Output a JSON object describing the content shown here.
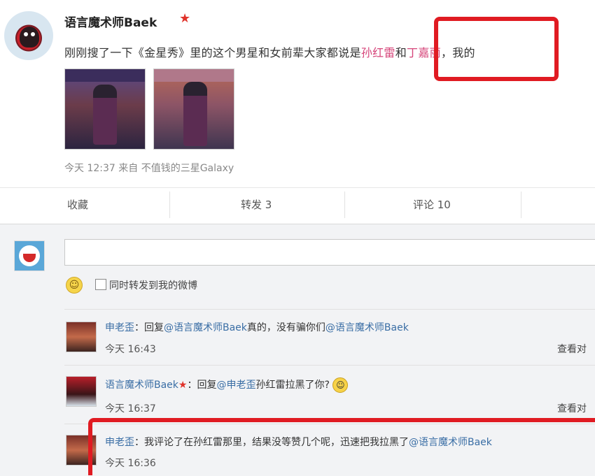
{
  "post": {
    "username": "语言魔术师Baek",
    "star": "★",
    "text_before": "刚刚搜了一下《金星秀》里的这个男星和女前辈大家都说是",
    "name1": "孙红雷",
    "and": "和",
    "name2": "丁嘉丽",
    "text_after": "，我的",
    "meta": "今天 12:37 来自 不值钱的三星Galaxy"
  },
  "actions": {
    "favorite": "收藏",
    "repost": "转发 3",
    "comment": "评论 10"
  },
  "composer": {
    "emoji": "☺",
    "repost_label": "同时转发到我的微博"
  },
  "comments": [
    {
      "user": "申老歪",
      "reply_prefix": "：回复",
      "mention": "@语言魔术师Baek",
      "text": "真的，没有骗你们",
      "mention2": "@语言魔术师Baek",
      "time": "今天 16:43",
      "action": "查看对"
    },
    {
      "user": "语言魔术师Baek",
      "star": "★",
      "reply_prefix": "：回复",
      "mention": "@申老歪",
      "text": "孙红雷拉黑了你?",
      "time": "今天 16:37",
      "action": "查看对"
    },
    {
      "user": "申老歪",
      "text": "：我评论了在孙红雷那里，结果没等赞几个呢，迅速把我拉黑了",
      "mention": "@语言魔术师Baek",
      "time": "今天 16:36"
    }
  ],
  "colors": {
    "highlight_box": "#e01b22",
    "link": "#3a6ea5"
  }
}
